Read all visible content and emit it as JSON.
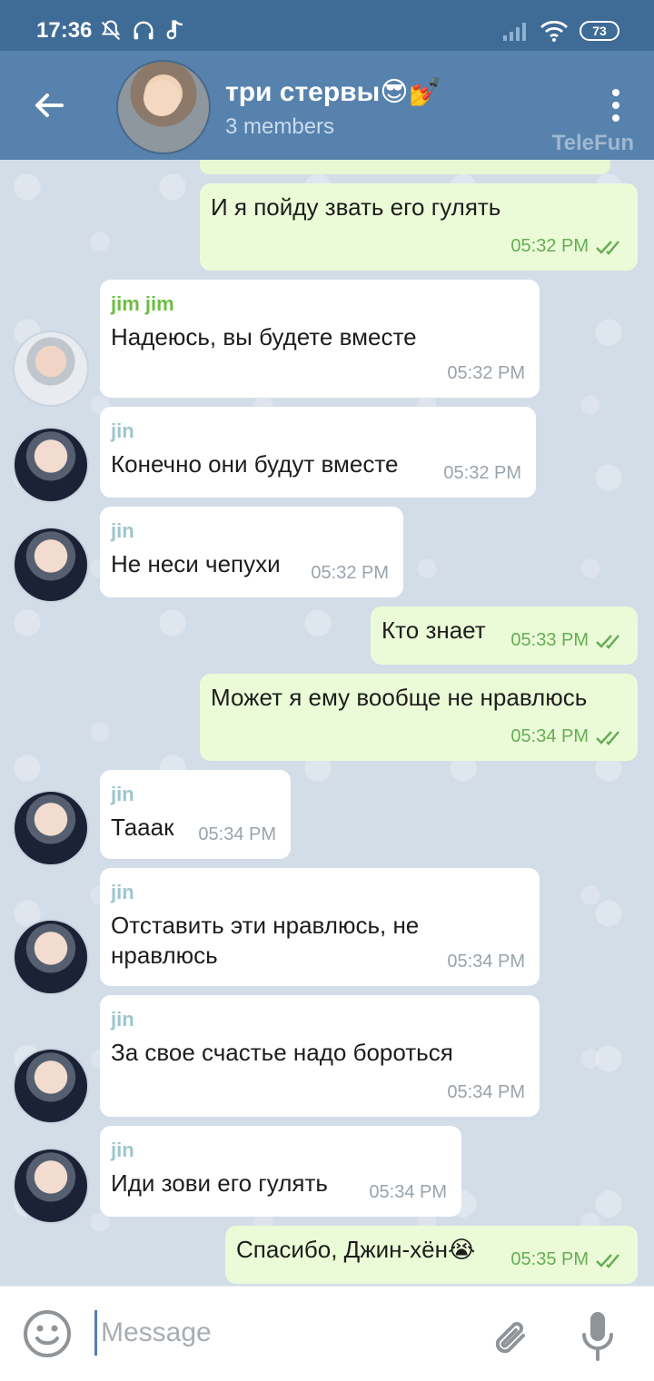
{
  "status_bar": {
    "time": "17:36",
    "battery": "73",
    "icons": [
      "bell-off-icon",
      "headphones-icon",
      "music-note-icon",
      "signal-icon",
      "wifi-icon",
      "battery-icon"
    ]
  },
  "header": {
    "title": "три стервы😎💅",
    "subtitle": "3 members",
    "watermark": "TeleFun"
  },
  "messages": [
    {
      "dir": "out",
      "text": "И я пойду звать его гулять",
      "time": "05:32 PM",
      "read": true
    },
    {
      "dir": "in",
      "sender": "jim jim",
      "text": "Надеюсь, вы будете вместе",
      "time": "05:32 PM"
    },
    {
      "dir": "in",
      "sender": "jin",
      "text": "Конечно они будут вместе",
      "time": "05:32 PM"
    },
    {
      "dir": "in",
      "sender": "jin",
      "text": "Не неси чепухи",
      "time": "05:32 PM"
    },
    {
      "dir": "out",
      "text": "Кто знает",
      "time": "05:33 PM",
      "read": true
    },
    {
      "dir": "out",
      "text": "Может я ему вообще не нравлюсь",
      "time": "05:34 PM",
      "read": true
    },
    {
      "dir": "in",
      "sender": "jin",
      "text": "Тааак",
      "time": "05:34 PM"
    },
    {
      "dir": "in",
      "sender": "jin",
      "text": "Отставить эти нравлюсь, не нравлюсь",
      "time": "05:34 PM"
    },
    {
      "dir": "in",
      "sender": "jin",
      "text": "За свое счастье надо бороться",
      "time": "05:34 PM"
    },
    {
      "dir": "in",
      "sender": "jin",
      "text": "Иди зови его гулять",
      "time": "05:34 PM"
    },
    {
      "dir": "out",
      "text": "Спасибо, Джин-хён😭",
      "time": "05:35 PM",
      "read": true
    }
  ],
  "input": {
    "placeholder": "Message"
  },
  "colors": {
    "header_bg": "#5782ad",
    "status_bg": "#3f6b97",
    "chat_bg": "#d3dde8",
    "outgoing_bubble": "#ebfbd7",
    "incoming_bubble": "#ffffff",
    "jim_sender": "#6ebd45",
    "jin_sender": "#9ec5cf"
  }
}
